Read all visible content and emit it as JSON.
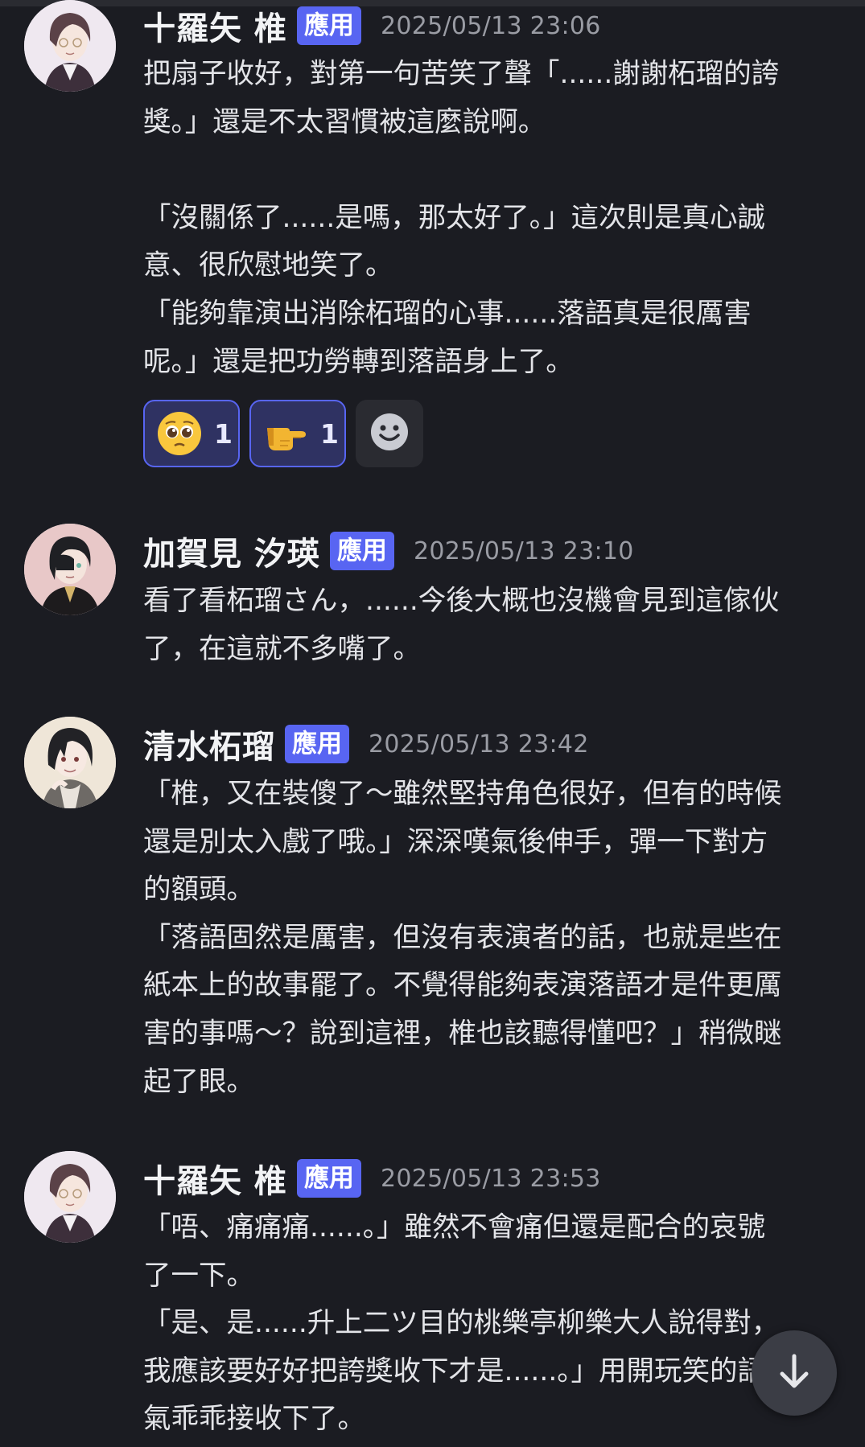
{
  "badge_label": "應用",
  "messages": [
    {
      "author": "十羅矢 椎",
      "timestamp": "2025/05/13 23:06",
      "text": "把扇子收好，對第一句苦笑了聲「......謝謝柘瑠的誇\n獎。」還是不太習慣被這麼說啊。\n\n「沒關係了......是嗎，那太好了。」這次則是真心誠\n意、很欣慰地笑了。\n「能夠靠演出消除柘瑠的心事......落語真是很厲害\n呢。」還是把功勞轉到落語身上了。",
      "reactions": [
        {
          "emoji": "pleading-face-emoji",
          "count": "1"
        },
        {
          "emoji": "pointing-hand-emoji",
          "count": "1"
        }
      ]
    },
    {
      "author": "加賀見 汐瑛",
      "timestamp": "2025/05/13 23:10",
      "text": "看了看柘瑠さん，......今後大概也沒機會見到這傢伙\n了，在這就不多嘴了。"
    },
    {
      "author": "清水柘瑠",
      "timestamp": "2025/05/13 23:42",
      "text": "「椎，又在裝傻了～雖然堅持角色很好，但有的時候\n還是別太入戲了哦。」深深嘆氣後伸手，彈一下對方\n的額頭。\n「落語固然是厲害，但沒有表演者的話，也就是些在\n紙本上的故事罷了。不覺得能夠表演落語才是件更厲\n害的事嗎～？說到這裡，椎也該聽得懂吧？」稍微瞇\n起了眼。"
    },
    {
      "author": "十羅矢 椎",
      "timestamp": "2025/05/13 23:53",
      "text": "「唔、痛痛痛......。」雖然不會痛但還是配合的哀號\n了一下。\n「是、是......升上二ツ目的桃樂亭柳樂大人說得對，\n我應該要好好把誇獎收下才是......。」用開玩笑的語\n氣乖乖接收下了。"
    }
  ],
  "icons": {
    "add_reaction": "smiley-add-reaction-icon",
    "scroll_down": "arrow-down-icon"
  },
  "colors": {
    "background": "#1b1c22",
    "badge": "#5865f2",
    "timestamp": "#9a9ca4",
    "reaction_active_bg": "#2f3262"
  }
}
